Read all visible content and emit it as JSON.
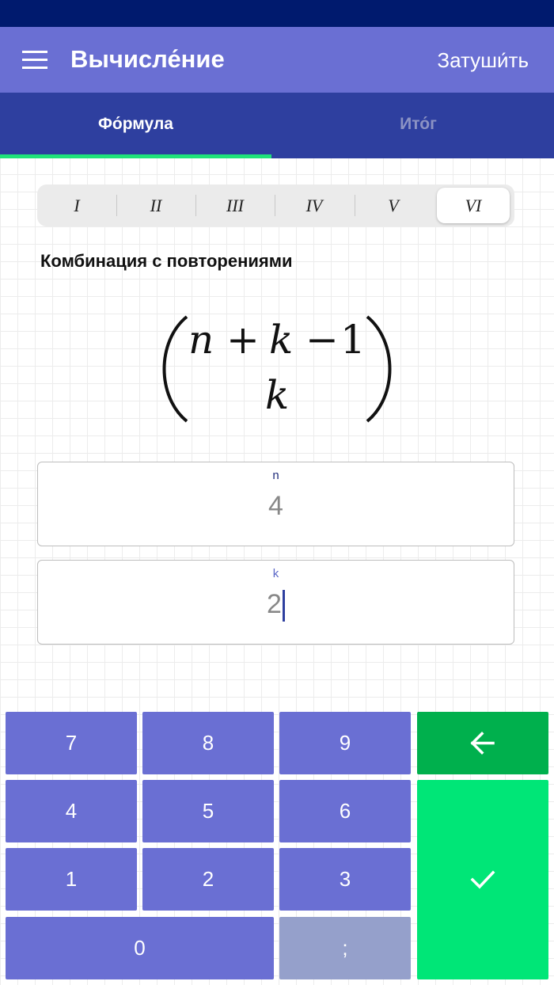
{
  "app": {
    "title": "Вычисле́ние",
    "action_label": "Затуши́ть",
    "menu_icon": "hamburger-menu-icon"
  },
  "tabs": [
    {
      "label": "Фо́рмула",
      "active": true
    },
    {
      "label": "Ито́г",
      "active": false
    }
  ],
  "formula_selector": {
    "options": [
      "I",
      "II",
      "III",
      "IV",
      "V",
      "VI"
    ],
    "selected": "VI"
  },
  "formula": {
    "name": "Комбинация с повторениями",
    "top": [
      "n",
      "+",
      "k",
      "−",
      "1"
    ],
    "bottom": "k"
  },
  "inputs": {
    "n": {
      "label": "n",
      "value": "4"
    },
    "k": {
      "label": "k",
      "value": "2"
    }
  },
  "keypad": {
    "keys": [
      "7",
      "8",
      "9",
      "4",
      "5",
      "6",
      "1",
      "2",
      "3",
      "0",
      ";"
    ],
    "backspace_icon": "backspace-arrow-icon",
    "confirm_icon": "checkmark-icon",
    "colors": {
      "key": "#6a6fd3",
      "disabled": "#95a0cb",
      "backspace": "#00b04d",
      "confirm": "#00e677"
    }
  },
  "colors": {
    "status_bar": "#001a6e",
    "app_bar": "#6a6fd3",
    "tab_bar": "#2e3f9f",
    "tab_indicator": "#1fe37a"
  }
}
